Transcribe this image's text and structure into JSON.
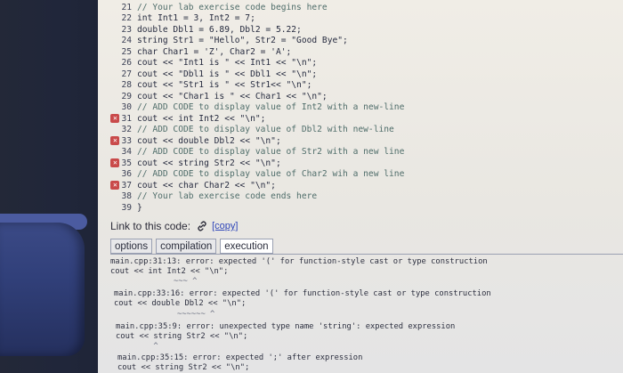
{
  "editor": {
    "lines": [
      {
        "num": "21",
        "error": false,
        "text": "// Your lab exercise code begins here"
      },
      {
        "num": "22",
        "error": false,
        "text": "int Int1 = 3, Int2 = 7;"
      },
      {
        "num": "23",
        "error": false,
        "text": "double Dbl1 = 6.89, Dbl2 = 5.22;"
      },
      {
        "num": "24",
        "error": false,
        "text": "string Str1 = \"Hello\", Str2 = \"Good Bye\";"
      },
      {
        "num": "25",
        "error": false,
        "text": "char Char1 = 'Z', Char2 = 'A';"
      },
      {
        "num": "26",
        "error": false,
        "text": "cout << \"Int1 is \" << Int1 << \"\\n\";"
      },
      {
        "num": "27",
        "error": false,
        "text": "cout << \"Dbl1 is \" << Dbl1 << \"\\n\";"
      },
      {
        "num": "28",
        "error": false,
        "text": "cout << \"Str1 is \" << Str1<< \"\\n\";"
      },
      {
        "num": "29",
        "error": false,
        "text": "cout << \"Char1 is \" << Char1 << \"\\n\";"
      },
      {
        "num": "30",
        "error": false,
        "text": "// ADD CODE to display value of Int2 with a new-line"
      },
      {
        "num": "31",
        "error": true,
        "text": "cout << int Int2 << \"\\n\";"
      },
      {
        "num": "32",
        "error": false,
        "text": "// ADD CODE to display value of Dbl2 with new-line"
      },
      {
        "num": "33",
        "error": true,
        "text": "cout << double Dbl2 << \"\\n\";"
      },
      {
        "num": "34",
        "error": false,
        "text": "// ADD CODE to display value of Str2 with a new line"
      },
      {
        "num": "35",
        "error": true,
        "text": "cout << string Str2 << \"\\n\";"
      },
      {
        "num": "36",
        "error": false,
        "text": "// ADD CODE to display value of Char2 wih a new line"
      },
      {
        "num": "37",
        "error": true,
        "text": "cout << char Char2 << \"\\n\";"
      },
      {
        "num": "38",
        "error": false,
        "text": "// Your lab exercise code ends here"
      },
      {
        "num": "39",
        "error": false,
        "text": "}"
      }
    ]
  },
  "link": {
    "label": "Link to this code:",
    "copy_label": "[copy]"
  },
  "tabs": [
    {
      "label": "options",
      "active": false
    },
    {
      "label": "compilation",
      "active": false
    },
    {
      "label": "execution",
      "active": true
    }
  ],
  "output": {
    "lines": [
      "main.cpp:31:13: error: expected '(' for function-style cast or type construction",
      "cout << int Int2 << \"\\n\";",
      "          ~~~ ^",
      "main.cpp:33:16: error: expected '(' for function-style cast or type construction",
      "cout << double Dbl2 << \"\\n\";",
      "          ~~~~~~ ^",
      "main.cpp:35:9: error: unexpected type name 'string': expected expression",
      "cout << string Str2 << \"\\n\";",
      "        ^",
      "main.cpp:35:15: error: expected ';' after expression",
      "cout << string Str2 << \"\\n\";"
    ]
  },
  "colors": {
    "error_marker": "#c94a4a",
    "link": "#2e45b8",
    "keyword": "#2f3da2",
    "comment": "#4f6d6a"
  }
}
